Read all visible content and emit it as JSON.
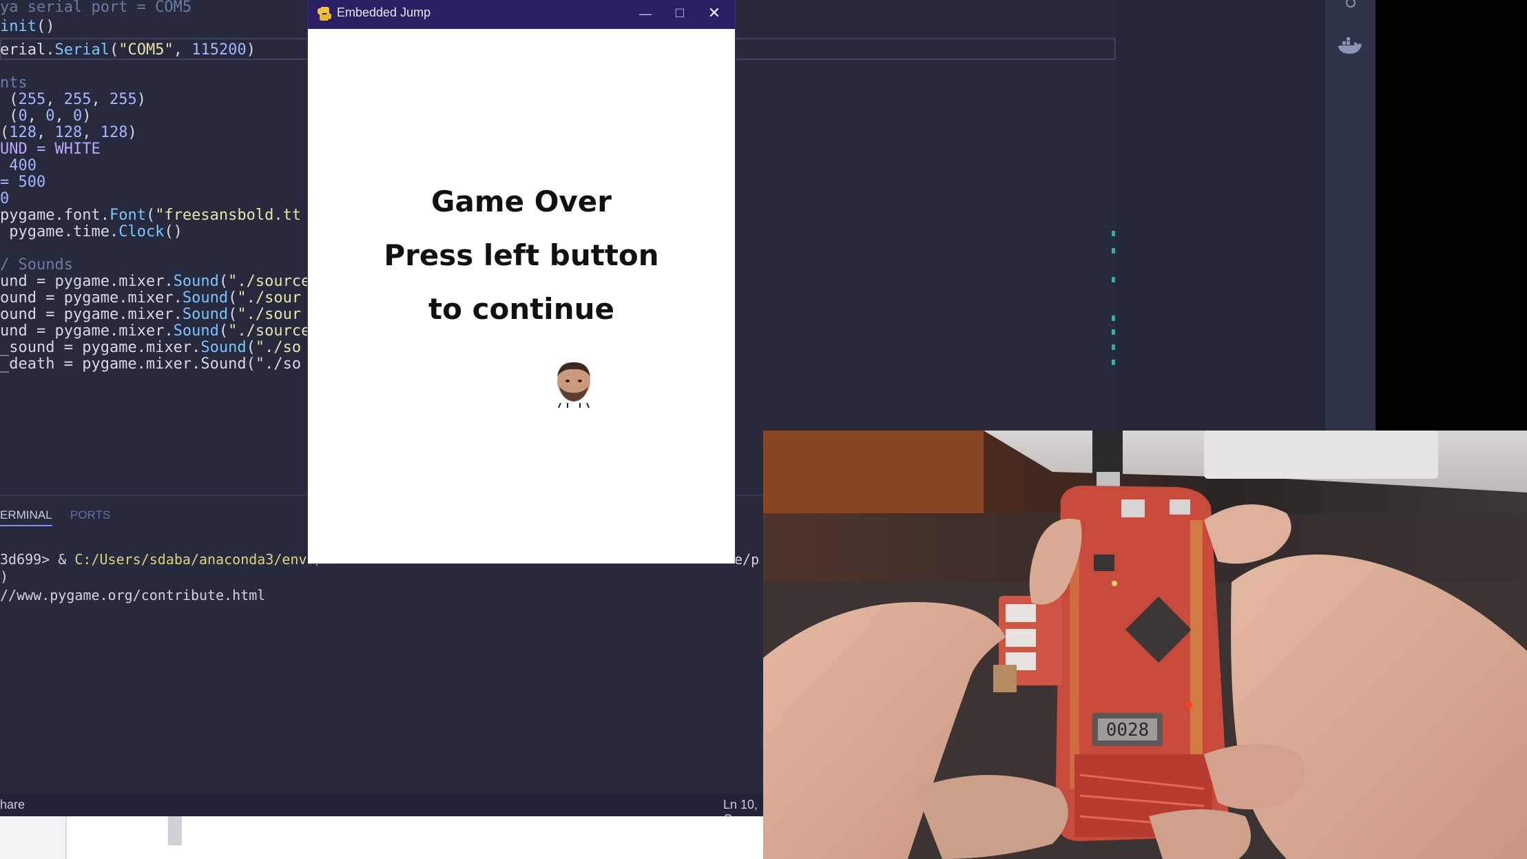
{
  "editor": {
    "code_lines": [
      {
        "segments": [
          {
            "t": "ya serial port = COM5",
            "c": "tok-cm"
          }
        ]
      },
      {
        "segments": [
          {
            "t": "init",
            "c": "tok-fn"
          },
          {
            "t": "()",
            "c": ""
          }
        ]
      },
      {
        "segments": [
          {
            "t": "erial.",
            "c": ""
          },
          {
            "t": "Serial",
            "c": "tok-fn"
          },
          {
            "t": "(",
            "c": ""
          },
          {
            "t": "\"COM5\"",
            "c": "tok-str"
          },
          {
            "t": ", ",
            "c": ""
          },
          {
            "t": "115200",
            "c": "tok-num"
          },
          {
            "t": ")",
            "c": ""
          }
        ]
      },
      {
        "segments": [
          {
            "t": "",
            "c": ""
          }
        ]
      },
      {
        "segments": [
          {
            "t": "nts",
            "c": "tok-cm"
          }
        ]
      },
      {
        "segments": [
          {
            "t": " (",
            "c": ""
          },
          {
            "t": "255",
            "c": "tok-num"
          },
          {
            "t": ", ",
            "c": ""
          },
          {
            "t": "255",
            "c": "tok-num"
          },
          {
            "t": ", ",
            "c": ""
          },
          {
            "t": "255",
            "c": "tok-num"
          },
          {
            "t": ")",
            "c": ""
          }
        ]
      },
      {
        "segments": [
          {
            "t": " (",
            "c": ""
          },
          {
            "t": "0",
            "c": "tok-num"
          },
          {
            "t": ", ",
            "c": ""
          },
          {
            "t": "0",
            "c": "tok-num"
          },
          {
            "t": ", ",
            "c": ""
          },
          {
            "t": "0",
            "c": "tok-num"
          },
          {
            "t": ")",
            "c": ""
          }
        ]
      },
      {
        "segments": [
          {
            "t": "(",
            "c": ""
          },
          {
            "t": "128",
            "c": "tok-num"
          },
          {
            "t": ", ",
            "c": ""
          },
          {
            "t": "128",
            "c": "tok-num"
          },
          {
            "t": ", ",
            "c": ""
          },
          {
            "t": "128",
            "c": "tok-num"
          },
          {
            "t": ")",
            "c": ""
          }
        ]
      },
      {
        "segments": [
          {
            "t": "UND = WHITE",
            "c": "tok-var"
          }
        ]
      },
      {
        "segments": [
          {
            "t": " 400",
            "c": "tok-num"
          }
        ]
      },
      {
        "segments": [
          {
            "t": "= 500",
            "c": "tok-num"
          }
        ]
      },
      {
        "segments": [
          {
            "t": "0",
            "c": "tok-num"
          }
        ]
      },
      {
        "segments": [
          {
            "t": "pygame",
            "c": ""
          },
          {
            "t": ".font.",
            "c": ""
          },
          {
            "t": "Font",
            "c": "tok-fn"
          },
          {
            "t": "(",
            "c": ""
          },
          {
            "t": "\"freesansbold.tt",
            "c": "tok-str"
          }
        ]
      },
      {
        "segments": [
          {
            "t": " pygame",
            "c": ""
          },
          {
            "t": ".time.",
            "c": ""
          },
          {
            "t": "Clock",
            "c": "tok-fn"
          },
          {
            "t": "()",
            "c": ""
          }
        ]
      },
      {
        "segments": [
          {
            "t": "",
            "c": ""
          }
        ]
      },
      {
        "segments": [
          {
            "t": "/ Sounds",
            "c": "tok-cm"
          }
        ]
      },
      {
        "segments": [
          {
            "t": "und = ",
            "c": ""
          },
          {
            "t": "pygame",
            "c": ""
          },
          {
            "t": ".mixer.",
            "c": ""
          },
          {
            "t": "Sound",
            "c": "tok-fn"
          },
          {
            "t": "(",
            "c": ""
          },
          {
            "t": "\"./source",
            "c": "tok-str"
          }
        ]
      },
      {
        "segments": [
          {
            "t": "ound = ",
            "c": ""
          },
          {
            "t": "pygame",
            "c": ""
          },
          {
            "t": ".mixer.",
            "c": ""
          },
          {
            "t": "Sound",
            "c": "tok-fn"
          },
          {
            "t": "(",
            "c": ""
          },
          {
            "t": "\"./sour",
            "c": "tok-str"
          }
        ]
      },
      {
        "segments": [
          {
            "t": "ound = ",
            "c": ""
          },
          {
            "t": "pygame",
            "c": ""
          },
          {
            "t": ".mixer.",
            "c": ""
          },
          {
            "t": "Sound",
            "c": "tok-fn"
          },
          {
            "t": "(",
            "c": ""
          },
          {
            "t": "\"./sour",
            "c": "tok-str"
          }
        ]
      },
      {
        "segments": [
          {
            "t": "und = ",
            "c": ""
          },
          {
            "t": "pygame",
            "c": ""
          },
          {
            "t": ".mixer.",
            "c": ""
          },
          {
            "t": "Sound",
            "c": "tok-fn"
          },
          {
            "t": "(",
            "c": ""
          },
          {
            "t": "\"./source",
            "c": "tok-str"
          }
        ]
      },
      {
        "segments": [
          {
            "t": "_sound = ",
            "c": ""
          },
          {
            "t": "pygame",
            "c": ""
          },
          {
            "t": ".mixer.",
            "c": ""
          },
          {
            "t": "Sound",
            "c": "tok-fn"
          },
          {
            "t": "(",
            "c": ""
          },
          {
            "t": "\"./so",
            "c": "tok-str"
          }
        ]
      },
      {
        "segments": [
          {
            "t": "_death = pygame.mixer.Sound(\"./so",
            "c": ""
          }
        ]
      }
    ]
  },
  "panel": {
    "tab_terminal": "ERMINAL",
    "tab_ports": "PORTS",
    "terminal_prompt": "3d699> & ",
    "terminal_path": "C:/Users/sdaba/anaconda3/envs/3",
    "terminal_path_tail": "e/p",
    "terminal_line2": ")",
    "terminal_line3": "//www.pygame.org/contribute.html"
  },
  "status_bar": {
    "left": "hare",
    "right": "Ln 10, C"
  },
  "game_window": {
    "title": "Embedded Jump",
    "minimize": "—",
    "maximize": "☐",
    "close": "✕",
    "line1": "Game Over",
    "line2": "Press left button",
    "line3": "to continue"
  },
  "camera": {
    "lcd_display": "0028"
  },
  "icons": [
    "python-icon",
    "settings-icon",
    "docker-icon",
    "player-face-icon"
  ]
}
